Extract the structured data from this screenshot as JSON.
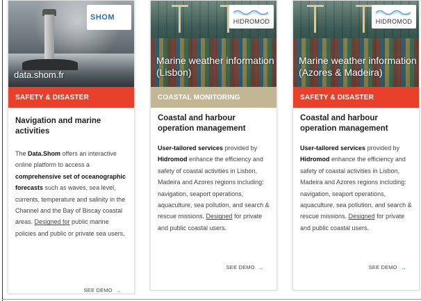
{
  "cards": [
    {
      "hero_title": "data.shom.fr",
      "logo_text": "SHOM",
      "category": "SAFETY & DISASTER",
      "category_color": "#e8402b",
      "title": "Navigation and marine activities",
      "desc": {
        "p1": "The ",
        "b1": "Data.Shom",
        "p2": " offers an interactive online platform to access a ",
        "b2": "comprehensive set of oceanographic forecasts",
        "p3": " such as waves, sea level, currents, temperature and salinity in the Channel and the Bay of Biscay coastal areas. ",
        "u1": "Designed for",
        "p4": " public marine policies and public or private sea users."
      },
      "cta": "SEE DEMO",
      "cta_icon": "arrow-right"
    },
    {
      "hero_title_line1": "Marine weather information",
      "hero_title_line2": "(Lisbon)",
      "logo_text": "HIDROMOD",
      "category": "COASTAL MONITORING",
      "category_color": "#c3b694",
      "title": "Coastal and harbour operation management",
      "desc": {
        "b1": "User-tailored services",
        "p1": " provided by ",
        "b2": "Hidromod",
        "p2": " enhance the efficiency and safety of coastal activities in Lisbon, Madeira and Azores regions including: navigation, seaport operations, aquaculture, sea pollution, and search & rescue missions. ",
        "u1": "Designed",
        "p3": " for private and public coastal users."
      },
      "cta": "SEE DEMO",
      "cta_icon": "arrow-right"
    },
    {
      "hero_title_line1": "Marine weather information",
      "hero_title_line2": "(Azores & Madeira)",
      "logo_text": "HIDROMOD",
      "category": "SAFETY & DISASTER",
      "category_color": "#e8402b",
      "title": "Coastal and harbour operation management",
      "desc": {
        "b1": "User-tailored services",
        "p1": " provided by ",
        "b2": "Hidromod",
        "p2": " enhance the efficiency and safety of coastal activities in Lisbon, Madeira and Azores regions including: navigation, seaport operations, aquaculture, sea pollution, and search & rescue missions. ",
        "u1": "Designed",
        "p3": " for private and public coastal users."
      },
      "cta": "SEE DEMO",
      "cta_icon": "arrow-right"
    }
  ],
  "accent_color": "#3a9be0"
}
